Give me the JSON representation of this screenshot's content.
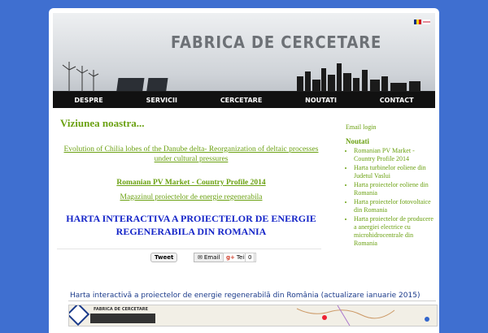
{
  "header": {
    "site_title": "FABRICA DE CERCETARE"
  },
  "nav": {
    "items": [
      "DESPRE",
      "SERVICII",
      "CERCETARE",
      "NOUTATI",
      "CONTACT"
    ]
  },
  "main": {
    "heading": "Viziunea noastra...",
    "link1": "Evolution of Chilia lobes of the Danube delta- Reorganization of deltaic processes under cultural pressures",
    "link2": "Romanian PV Market - Country Profile 2014",
    "link3": "Magazinul proiectelor de energie regenerabila",
    "big_link": "HARTA INTERACTIVA A PROIECTELOR DE ENERGIE REGENERABILA DIN ROMANIA"
  },
  "share": {
    "tweet": "Tweet",
    "email": "Email",
    "gplus": "Teilen",
    "count": "0"
  },
  "sidebar": {
    "email_login": "Email login",
    "news_title": "Noutati",
    "news_items": [
      "Romanian PV Market - Country Profile 2014",
      "Harta turbinelor eoliene din Judetul Vaslui",
      "Harta proiectelor eoliene din Romania",
      "Harta proiectelor fotovoltaice din Romania",
      "Harta proiectelor de producere a anergiei electrice cu microhidrocentrale din Romania"
    ]
  },
  "map": {
    "title": "Harta interactivă a proiectelor de energie regenerabilă din România (actualizare ianuarie 2015)",
    "logo_text": "FABRICA DE CERCETARE"
  }
}
